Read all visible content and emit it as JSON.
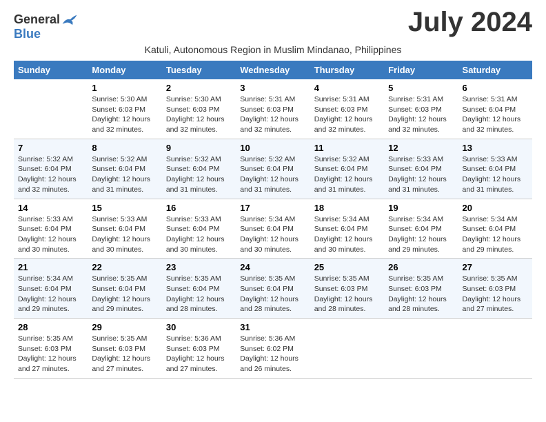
{
  "logo": {
    "general": "General",
    "blue": "Blue"
  },
  "title": "July 2024",
  "subtitle": "Katuli, Autonomous Region in Muslim Mindanao, Philippines",
  "days_header": [
    "Sunday",
    "Monday",
    "Tuesday",
    "Wednesday",
    "Thursday",
    "Friday",
    "Saturday"
  ],
  "weeks": [
    [
      {
        "day": "",
        "sunrise": "",
        "sunset": "",
        "daylight": ""
      },
      {
        "day": "1",
        "sunrise": "Sunrise: 5:30 AM",
        "sunset": "Sunset: 6:03 PM",
        "daylight": "Daylight: 12 hours and 32 minutes."
      },
      {
        "day": "2",
        "sunrise": "Sunrise: 5:30 AM",
        "sunset": "Sunset: 6:03 PM",
        "daylight": "Daylight: 12 hours and 32 minutes."
      },
      {
        "day": "3",
        "sunrise": "Sunrise: 5:31 AM",
        "sunset": "Sunset: 6:03 PM",
        "daylight": "Daylight: 12 hours and 32 minutes."
      },
      {
        "day": "4",
        "sunrise": "Sunrise: 5:31 AM",
        "sunset": "Sunset: 6:03 PM",
        "daylight": "Daylight: 12 hours and 32 minutes."
      },
      {
        "day": "5",
        "sunrise": "Sunrise: 5:31 AM",
        "sunset": "Sunset: 6:03 PM",
        "daylight": "Daylight: 12 hours and 32 minutes."
      },
      {
        "day": "6",
        "sunrise": "Sunrise: 5:31 AM",
        "sunset": "Sunset: 6:04 PM",
        "daylight": "Daylight: 12 hours and 32 minutes."
      }
    ],
    [
      {
        "day": "7",
        "sunrise": "Sunrise: 5:32 AM",
        "sunset": "Sunset: 6:04 PM",
        "daylight": "Daylight: 12 hours and 32 minutes."
      },
      {
        "day": "8",
        "sunrise": "Sunrise: 5:32 AM",
        "sunset": "Sunset: 6:04 PM",
        "daylight": "Daylight: 12 hours and 31 minutes."
      },
      {
        "day": "9",
        "sunrise": "Sunrise: 5:32 AM",
        "sunset": "Sunset: 6:04 PM",
        "daylight": "Daylight: 12 hours and 31 minutes."
      },
      {
        "day": "10",
        "sunrise": "Sunrise: 5:32 AM",
        "sunset": "Sunset: 6:04 PM",
        "daylight": "Daylight: 12 hours and 31 minutes."
      },
      {
        "day": "11",
        "sunrise": "Sunrise: 5:32 AM",
        "sunset": "Sunset: 6:04 PM",
        "daylight": "Daylight: 12 hours and 31 minutes."
      },
      {
        "day": "12",
        "sunrise": "Sunrise: 5:33 AM",
        "sunset": "Sunset: 6:04 PM",
        "daylight": "Daylight: 12 hours and 31 minutes."
      },
      {
        "day": "13",
        "sunrise": "Sunrise: 5:33 AM",
        "sunset": "Sunset: 6:04 PM",
        "daylight": "Daylight: 12 hours and 31 minutes."
      }
    ],
    [
      {
        "day": "14",
        "sunrise": "Sunrise: 5:33 AM",
        "sunset": "Sunset: 6:04 PM",
        "daylight": "Daylight: 12 hours and 30 minutes."
      },
      {
        "day": "15",
        "sunrise": "Sunrise: 5:33 AM",
        "sunset": "Sunset: 6:04 PM",
        "daylight": "Daylight: 12 hours and 30 minutes."
      },
      {
        "day": "16",
        "sunrise": "Sunrise: 5:33 AM",
        "sunset": "Sunset: 6:04 PM",
        "daylight": "Daylight: 12 hours and 30 minutes."
      },
      {
        "day": "17",
        "sunrise": "Sunrise: 5:34 AM",
        "sunset": "Sunset: 6:04 PM",
        "daylight": "Daylight: 12 hours and 30 minutes."
      },
      {
        "day": "18",
        "sunrise": "Sunrise: 5:34 AM",
        "sunset": "Sunset: 6:04 PM",
        "daylight": "Daylight: 12 hours and 30 minutes."
      },
      {
        "day": "19",
        "sunrise": "Sunrise: 5:34 AM",
        "sunset": "Sunset: 6:04 PM",
        "daylight": "Daylight: 12 hours and 29 minutes."
      },
      {
        "day": "20",
        "sunrise": "Sunrise: 5:34 AM",
        "sunset": "Sunset: 6:04 PM",
        "daylight": "Daylight: 12 hours and 29 minutes."
      }
    ],
    [
      {
        "day": "21",
        "sunrise": "Sunrise: 5:34 AM",
        "sunset": "Sunset: 6:04 PM",
        "daylight": "Daylight: 12 hours and 29 minutes."
      },
      {
        "day": "22",
        "sunrise": "Sunrise: 5:35 AM",
        "sunset": "Sunset: 6:04 PM",
        "daylight": "Daylight: 12 hours and 29 minutes."
      },
      {
        "day": "23",
        "sunrise": "Sunrise: 5:35 AM",
        "sunset": "Sunset: 6:04 PM",
        "daylight": "Daylight: 12 hours and 28 minutes."
      },
      {
        "day": "24",
        "sunrise": "Sunrise: 5:35 AM",
        "sunset": "Sunset: 6:04 PM",
        "daylight": "Daylight: 12 hours and 28 minutes."
      },
      {
        "day": "25",
        "sunrise": "Sunrise: 5:35 AM",
        "sunset": "Sunset: 6:03 PM",
        "daylight": "Daylight: 12 hours and 28 minutes."
      },
      {
        "day": "26",
        "sunrise": "Sunrise: 5:35 AM",
        "sunset": "Sunset: 6:03 PM",
        "daylight": "Daylight: 12 hours and 28 minutes."
      },
      {
        "day": "27",
        "sunrise": "Sunrise: 5:35 AM",
        "sunset": "Sunset: 6:03 PM",
        "daylight": "Daylight: 12 hours and 27 minutes."
      }
    ],
    [
      {
        "day": "28",
        "sunrise": "Sunrise: 5:35 AM",
        "sunset": "Sunset: 6:03 PM",
        "daylight": "Daylight: 12 hours and 27 minutes."
      },
      {
        "day": "29",
        "sunrise": "Sunrise: 5:35 AM",
        "sunset": "Sunset: 6:03 PM",
        "daylight": "Daylight: 12 hours and 27 minutes."
      },
      {
        "day": "30",
        "sunrise": "Sunrise: 5:36 AM",
        "sunset": "Sunset: 6:03 PM",
        "daylight": "Daylight: 12 hours and 27 minutes."
      },
      {
        "day": "31",
        "sunrise": "Sunrise: 5:36 AM",
        "sunset": "Sunset: 6:02 PM",
        "daylight": "Daylight: 12 hours and 26 minutes."
      },
      {
        "day": "",
        "sunrise": "",
        "sunset": "",
        "daylight": ""
      },
      {
        "day": "",
        "sunrise": "",
        "sunset": "",
        "daylight": ""
      },
      {
        "day": "",
        "sunrise": "",
        "sunset": "",
        "daylight": ""
      }
    ]
  ]
}
